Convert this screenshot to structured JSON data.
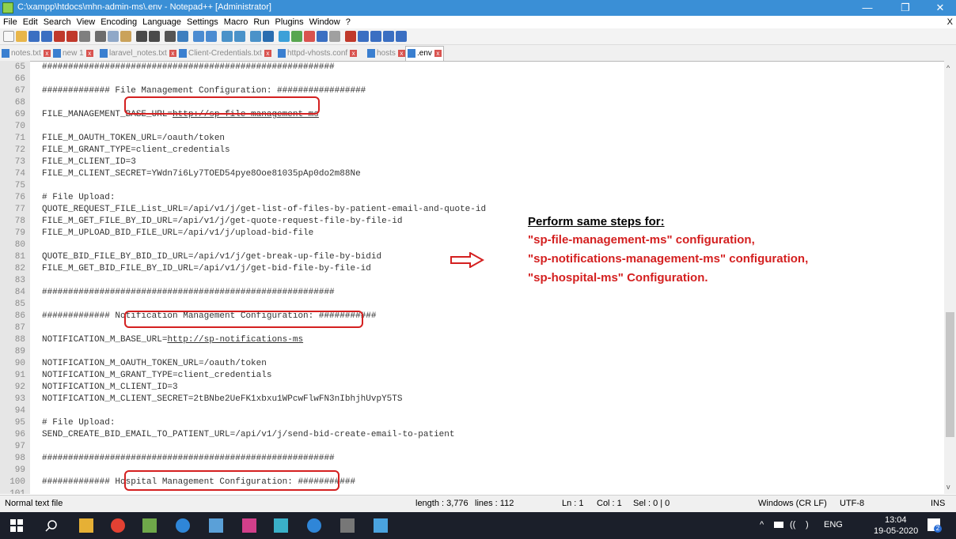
{
  "window": {
    "title": "C:\\xampp\\htdocs\\mhn-admin-ms\\.env - Notepad++ [Administrator]",
    "minimize": "—",
    "maximize": "❐",
    "close": "✕"
  },
  "menu": {
    "items": [
      "File",
      "Edit",
      "Search",
      "View",
      "Encoding",
      "Language",
      "Settings",
      "Macro",
      "Run",
      "Plugins",
      "Window",
      "?"
    ],
    "close_label": "X"
  },
  "tabs": [
    {
      "label": "notes.txt"
    },
    {
      "label": "new 1"
    },
    {
      "label": "laravel_notes.txt"
    },
    {
      "label": "Client-Credentials.txt"
    },
    {
      "label": "httpd-vhosts.conf"
    },
    {
      "label": "hosts"
    },
    {
      "label": ".env"
    }
  ],
  "editor": {
    "lines": [
      {
        "n": "65",
        "t": "########################################################"
      },
      {
        "n": "66",
        "t": ""
      },
      {
        "n": "67",
        "t": "############# File Management Configuration: #################"
      },
      {
        "n": "68",
        "t": ""
      },
      {
        "n": "69",
        "t": "FILE_MANAGEMENT_BASE_URL=",
        "u": "http://sp-file-management-ms"
      },
      {
        "n": "70",
        "t": ""
      },
      {
        "n": "71",
        "t": "FILE_M_OAUTH_TOKEN_URL=/oauth/token"
      },
      {
        "n": "72",
        "t": "FILE_M_GRANT_TYPE=client_credentials"
      },
      {
        "n": "73",
        "t": "FILE_M_CLIENT_ID=3"
      },
      {
        "n": "74",
        "t": "FILE_M_CLIENT_SECRET=YWdn7i6Ly7TOED54pye8Ooe81035pAp0do2m88Ne"
      },
      {
        "n": "75",
        "t": ""
      },
      {
        "n": "76",
        "t": "# File Upload:"
      },
      {
        "n": "77",
        "t": "QUOTE_REQUEST_FILE_List_URL=/api/v1/j/get-list-of-files-by-patient-email-and-quote-id"
      },
      {
        "n": "78",
        "t": "FILE_M_GET_FILE_BY_ID_URL=/api/v1/j/get-quote-request-file-by-file-id"
      },
      {
        "n": "79",
        "t": "FILE_M_UPLOAD_BID_FILE_URL=/api/v1/j/upload-bid-file"
      },
      {
        "n": "80",
        "t": ""
      },
      {
        "n": "81",
        "t": "QUOTE_BID_FILE_BY_BID_ID_URL=/api/v1/j/get-break-up-file-by-bidid"
      },
      {
        "n": "82",
        "t": "FILE_M_GET_BID_FILE_BY_ID_URL=/api/v1/j/get-bid-file-by-file-id"
      },
      {
        "n": "83",
        "t": ""
      },
      {
        "n": "84",
        "t": "########################################################"
      },
      {
        "n": "85",
        "t": ""
      },
      {
        "n": "86",
        "t": "############# Notification Management Configuration: ###########"
      },
      {
        "n": "87",
        "t": ""
      },
      {
        "n": "88",
        "t": "NOTIFICATION_M_BASE_URL=",
        "u": "http://sp-notifications-ms"
      },
      {
        "n": "89",
        "t": ""
      },
      {
        "n": "90",
        "t": "NOTIFICATION_M_OAUTH_TOKEN_URL=/oauth/token"
      },
      {
        "n": "91",
        "t": "NOTIFICATION_M_GRANT_TYPE=client_credentials"
      },
      {
        "n": "92",
        "t": "NOTIFICATION_M_CLIENT_ID=3"
      },
      {
        "n": "93",
        "t": "NOTIFICATION_M_CLIENT_SECRET=2tBNbe2UeFK1xbxu1WPcwFlwFN3nIbhjhUvpY5TS"
      },
      {
        "n": "94",
        "t": ""
      },
      {
        "n": "95",
        "t": "# File Upload:"
      },
      {
        "n": "96",
        "t": "SEND_CREATE_BID_EMAIL_TO_PATIENT_URL=/api/v1/j/send-bid-create-email-to-patient"
      },
      {
        "n": "97",
        "t": ""
      },
      {
        "n": "98",
        "t": "########################################################"
      },
      {
        "n": "99",
        "t": ""
      },
      {
        "n": "100",
        "t": "############# Hospital Management Configuration: ###########"
      },
      {
        "n": "101",
        "t": ""
      }
    ]
  },
  "annotation": {
    "heading": "Perform same steps for:",
    "lines": [
      "\"sp-file-management-ms\" configuration,",
      "\"sp-notifications-management-ms\" configuration,",
      "\"sp-hospital-ms\" Configuration."
    ]
  },
  "status": {
    "filetype": "Normal text file",
    "length": "length : 3,776",
    "lines": "lines : 112",
    "ln": "Ln : 1",
    "col": "Col : 1",
    "sel": "Sel : 0 | 0",
    "eol": "Windows (CR LF)",
    "encoding": "UTF-8",
    "mode": "INS"
  },
  "taskbar": {
    "time": "13:04",
    "date": "19-05-2020",
    "lang": "ENG",
    "notification_count": "2"
  },
  "colors": {
    "titlebar": "#3a8fd6",
    "annotation_red": "#d42020",
    "taskbar": "#1b1f2a"
  }
}
